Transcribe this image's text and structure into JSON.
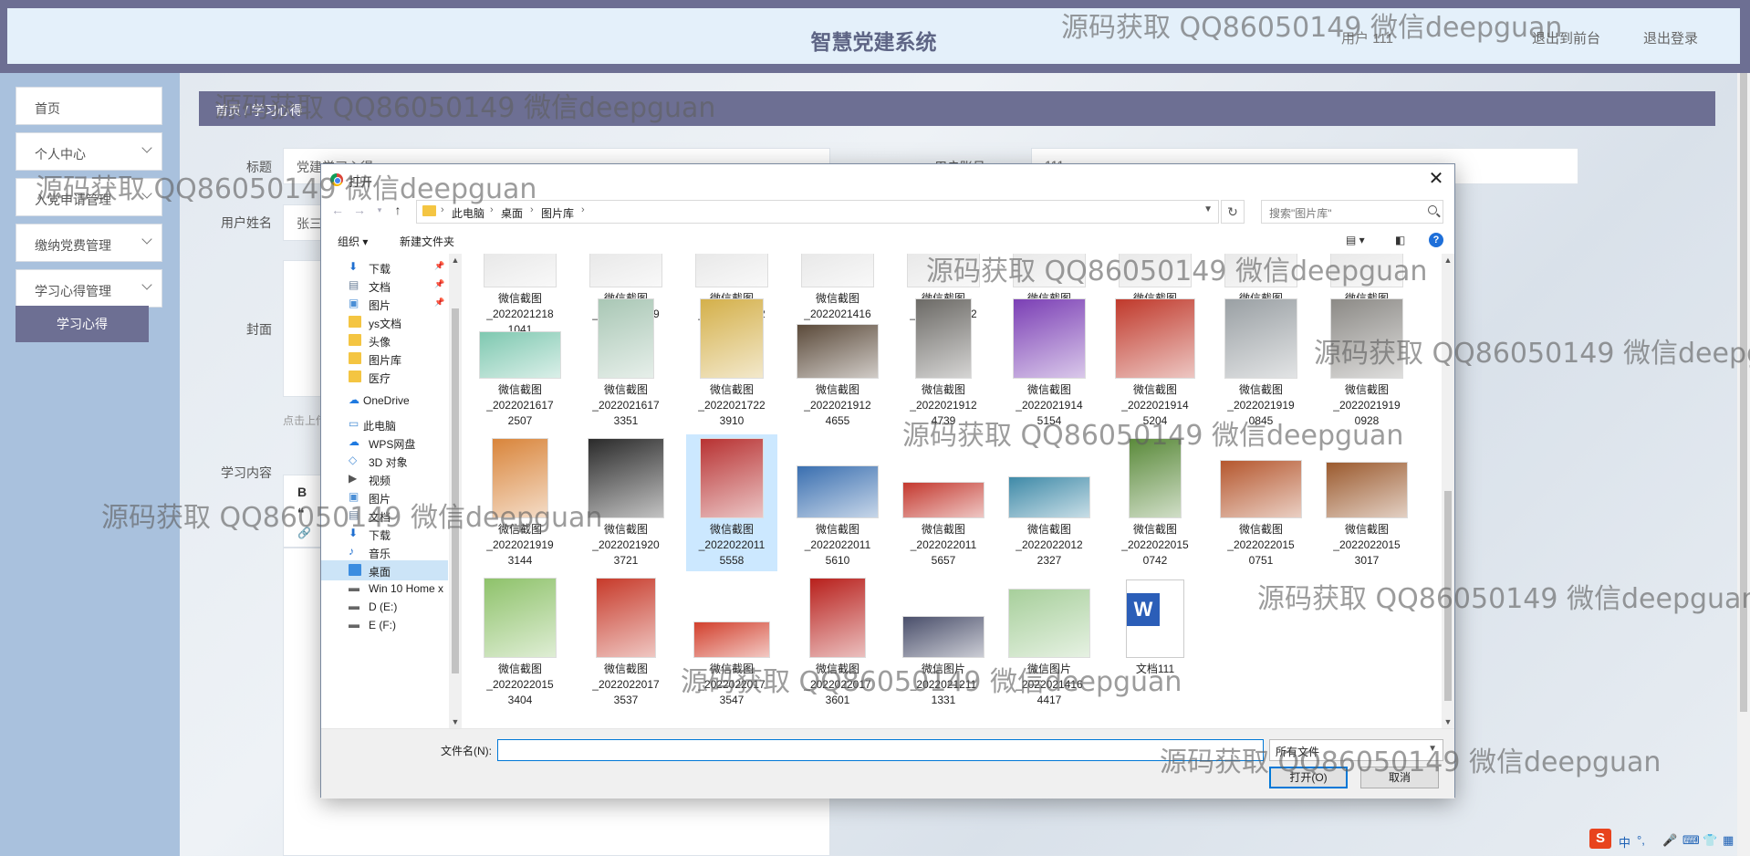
{
  "header": {
    "title": "智慧党建系统",
    "user": "用户 111",
    "front": "退出到前台",
    "logout": "退出登录"
  },
  "sidebar": {
    "items": [
      {
        "label": "首页"
      },
      {
        "label": "个人中心"
      },
      {
        "label": "入党申请管理"
      },
      {
        "label": "缴纳党费管理"
      },
      {
        "label": "学习心得管理"
      }
    ],
    "active": "学习心得"
  },
  "main": {
    "breadcrumb": "首页 / 学习心得",
    "labels": {
      "title": "标题",
      "user_account": "用户账号",
      "user_name": "用户姓名",
      "cover": "封面",
      "content": "学习内容",
      "upload_hint": "点击上传"
    },
    "values": {
      "title": "党建学习心得",
      "user_account": "111",
      "user_name": "张三"
    },
    "editor_tools": [
      "B",
      "❝",
      "🔗"
    ]
  },
  "dialog": {
    "title": "打开",
    "path": [
      "此电脑",
      "桌面",
      "图片库"
    ],
    "search_placeholder": "搜索\"图片库\"",
    "commands": {
      "organize": "组织 ▾",
      "new_folder": "新建文件夹"
    },
    "nav_items": [
      {
        "label": "下载",
        "icon": "download-icon",
        "pin": true
      },
      {
        "label": "文档",
        "icon": "document-icon",
        "pin": true
      },
      {
        "label": "图片",
        "icon": "picture-icon",
        "pin": true
      },
      {
        "label": "ys文档",
        "icon": "folder-icon",
        "pin": false
      },
      {
        "label": "头像",
        "icon": "folder-icon",
        "pin": false
      },
      {
        "label": "图片库",
        "icon": "folder-icon",
        "pin": false
      },
      {
        "label": "医疗",
        "icon": "folder-icon",
        "pin": false
      },
      {
        "label": "OneDrive",
        "icon": "cloud-icon",
        "pin": false
      },
      {
        "label": "此电脑",
        "icon": "computer-icon",
        "pin": false
      },
      {
        "label": "WPS网盘",
        "icon": "cloud-icon",
        "pin": false
      },
      {
        "label": "3D 对象",
        "icon": "cube-icon",
        "pin": false
      },
      {
        "label": "视频",
        "icon": "video-icon",
        "pin": false
      },
      {
        "label": "图片",
        "icon": "picture-icon",
        "pin": false
      },
      {
        "label": "文档",
        "icon": "document-icon",
        "pin": false
      },
      {
        "label": "下载",
        "icon": "download-icon",
        "pin": false
      },
      {
        "label": "音乐",
        "icon": "music-icon",
        "pin": false
      },
      {
        "label": "桌面",
        "icon": "desktop-icon",
        "pin": false,
        "selected": true
      },
      {
        "label": "Win 10 Home x",
        "icon": "drive-icon",
        "pin": false
      },
      {
        "label": "D (E:)",
        "icon": "drive-icon",
        "pin": false
      },
      {
        "label": "E (F:)",
        "icon": "drive-icon",
        "pin": false
      }
    ],
    "files": [
      {
        "name": "微信截图_20220212181041",
        "color": "#e8e8e8"
      },
      {
        "name": "微信截图_20220214091454",
        "color": "#e8e8e8"
      },
      {
        "name": "微信截图_20220214123139",
        "color": "#e8e8e8"
      },
      {
        "name": "微信截图_20220214165623",
        "color": "#e8e8e8"
      },
      {
        "name": "微信截图_20220215122752",
        "color": "#e8e8e8"
      },
      {
        "name": "微信截图_20220215122801",
        "color": "#e8e8e8"
      },
      {
        "name": "微信截图_20220215122815",
        "color": "#e8e8e8"
      },
      {
        "name": "微信截图_20220216094105",
        "color": "#e8e8e8"
      },
      {
        "name": "微信截图_20220216115756",
        "color": "#e8e8e8"
      },
      {
        "name": "微信截图_20220216172507",
        "color": "#7ec8b0"
      },
      {
        "name": "微信截图_20220216173351",
        "color": "#a9c7b5"
      },
      {
        "name": "微信截图_20220217223910",
        "color": "#d4b04a"
      },
      {
        "name": "微信截图_20220219124655",
        "color": "#5b4a3a"
      },
      {
        "name": "微信截图_20220219124739",
        "color": "#6c6a66"
      },
      {
        "name": "微信截图_20220219145154",
        "color": "#7b3fb5"
      },
      {
        "name": "微信截图_20220219145204",
        "color": "#c0392b"
      },
      {
        "name": "微信截图_20220219190845",
        "color": "#9aa0a4"
      },
      {
        "name": "微信截图_20220219190928",
        "color": "#8c8a86"
      },
      {
        "name": "微信截图_20220219193144",
        "color": "#d9853b"
      },
      {
        "name": "微信截图_20220219203721",
        "color": "#2a2a2a"
      },
      {
        "name": "微信截图_20220220115558",
        "color": "#b83232",
        "selected": true
      },
      {
        "name": "微信截图_20220220115610",
        "color": "#3a6fb0"
      },
      {
        "name": "微信截图_20220220115657",
        "color": "#c4392f"
      },
      {
        "name": "微信截图_20220220122327",
        "color": "#3f8aa8"
      },
      {
        "name": "微信截图_20220220150742",
        "color": "#5a8a3a"
      },
      {
        "name": "微信截图_20220220150751",
        "color": "#b5572e"
      },
      {
        "name": "微信截图_20220220153017",
        "color": "#9b5a2e"
      },
      {
        "name": "微信截图_20220220153404",
        "color": "#8ec26a"
      },
      {
        "name": "微信截图_20220220173537",
        "color": "#c73a2a"
      },
      {
        "name": "微信截图_20220220173547",
        "color": "#d2402d"
      },
      {
        "name": "微信截图_20220220173601",
        "color": "#b8201c"
      },
      {
        "name": "微信图片_20220212111331",
        "color": "#4a4f6b"
      },
      {
        "name": "微信图片_20220214164417",
        "color": "#a7cf9b"
      },
      {
        "name": "文档111",
        "color": "#ffffff",
        "word": true
      }
    ],
    "file_name_label": "文件名(N):",
    "file_name_value": "",
    "file_type": "所有文件",
    "open_button": "打开(O)",
    "cancel_button": "取消"
  },
  "watermark": "源码获取 QQ86050149 微信deepguan",
  "ime": {
    "logo": "S",
    "lang": "中",
    "punct": "°,"
  }
}
